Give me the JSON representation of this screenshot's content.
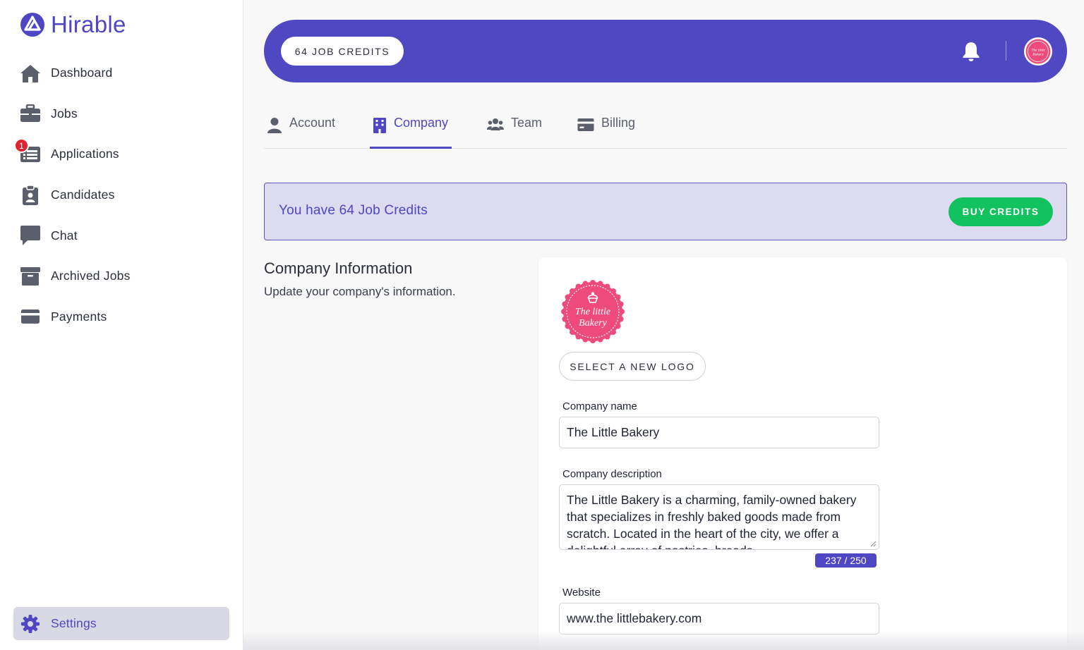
{
  "brand": {
    "name": "Hirable",
    "color": "#4f46c3"
  },
  "sidebar": {
    "items": [
      {
        "label": "Dashboard",
        "icon": "home-icon"
      },
      {
        "label": "Jobs",
        "icon": "briefcase-icon"
      },
      {
        "label": "Applications",
        "icon": "list-icon",
        "badge": "1"
      },
      {
        "label": "Candidates",
        "icon": "clipboard-user-icon"
      },
      {
        "label": "Chat",
        "icon": "chat-icon"
      },
      {
        "label": "Archived Jobs",
        "icon": "archive-icon"
      },
      {
        "label": "Payments",
        "icon": "credit-card-icon"
      }
    ],
    "settings": {
      "label": "Settings",
      "icon": "gear-icon"
    }
  },
  "header": {
    "credits_label": "64 JOB CREDITS",
    "bell_icon": "bell-icon",
    "avatar_logo": "bakery-logo"
  },
  "tabs": [
    {
      "label": "Account",
      "icon": "user-icon",
      "active": false
    },
    {
      "label": "Company",
      "icon": "building-icon",
      "active": true
    },
    {
      "label": "Team",
      "icon": "users-icon",
      "active": false
    },
    {
      "label": "Billing",
      "icon": "credit-card-icon",
      "active": false
    }
  ],
  "banner": {
    "text": "You have 64 Job Credits",
    "button": "BUY CREDITS",
    "button_color": "#12c25f"
  },
  "company_section": {
    "title": "Company Information",
    "subtitle": "Update your company's information.",
    "logo_text_line1": "The little",
    "logo_text_line2": "Bakery",
    "select_logo_button": "SELECT A NEW LOGO",
    "name_label": "Company name",
    "name_value": "The Little Bakery",
    "description_label": "Company description",
    "description_value": "The Little Bakery is a charming, family-owned bakery that specializes in freshly baked goods made from scratch. Located in the heart of the city, we offer a delightful array of pastries, breads",
    "description_counter": "237 / 250",
    "website_label": "Website",
    "website_value": "www.the littlebakery.com"
  },
  "colors": {
    "primary": "#5048c2",
    "accent_green": "#12c25f",
    "badge_red": "#e0222c",
    "logo_pink": "#ee4a7b"
  }
}
